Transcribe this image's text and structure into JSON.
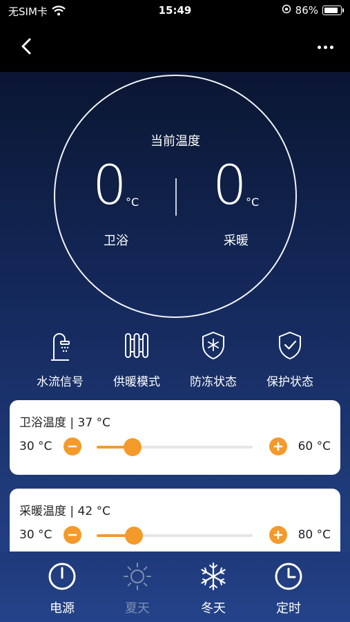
{
  "status_bar": {
    "carrier": "无SIM卡",
    "time": "15:49",
    "battery_text": "86%",
    "battery_level": 0.86
  },
  "dial": {
    "title": "当前温度",
    "bath": {
      "value": "0",
      "unit": "°C",
      "label": "卫浴"
    },
    "heating": {
      "value": "0",
      "unit": "°C",
      "label": "采暖"
    }
  },
  "indicators": [
    {
      "label": "水流信号",
      "icon": "shower-icon"
    },
    {
      "label": "供暖模式",
      "icon": "radiator-icon"
    },
    {
      "label": "防冻状态",
      "icon": "snowflake-shield-icon"
    },
    {
      "label": "保护状态",
      "icon": "check-shield-icon"
    }
  ],
  "cards": [
    {
      "title": "卫浴温度 | 37 °C",
      "min": "30 °C",
      "max": "60 °C",
      "level": 0.23
    },
    {
      "title": "采暖温度 | 42 °C",
      "min": "30 °C",
      "max": "80 °C",
      "level": 0.24
    }
  ],
  "tabs": [
    {
      "label": "电源",
      "icon": "power-icon",
      "active": true
    },
    {
      "label": "夏天",
      "icon": "sun-icon",
      "active": false
    },
    {
      "label": "冬天",
      "icon": "snowflake-icon",
      "active": true
    },
    {
      "label": "定时",
      "icon": "clock-icon",
      "active": true
    }
  ],
  "colors": {
    "accent": "#f39a2b",
    "tab_active": "#ffffff",
    "tab_inactive": "#7f8fb2",
    "background": "#14285a"
  }
}
